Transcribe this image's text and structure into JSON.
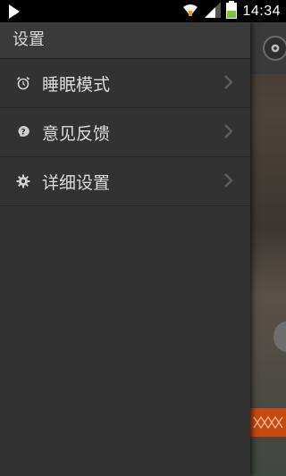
{
  "status_bar": {
    "time": "14:34"
  },
  "drawer": {
    "title": "设置",
    "items": [
      {
        "label": "睡眠模式",
        "icon": "alarm-clock-icon"
      },
      {
        "label": "意见反馈",
        "icon": "question-icon"
      },
      {
        "label": "详细设置",
        "icon": "gear-icon"
      }
    ]
  },
  "colors": {
    "drawer_bg": "#323232",
    "text": "#dcdcdc",
    "accent_orange": "#c64a10"
  }
}
